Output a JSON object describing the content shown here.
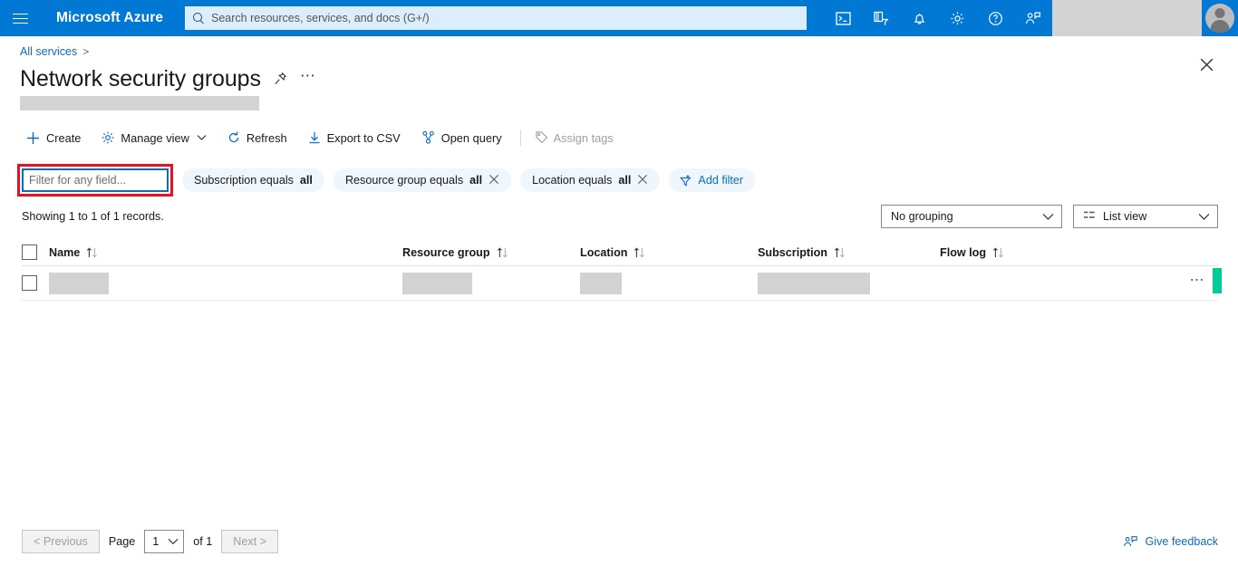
{
  "topbar": {
    "menu_icon": "hamburger-icon",
    "brand": "Microsoft Azure",
    "search": {
      "placeholder": "Search resources, services, and docs (G+/)",
      "icon": "search-icon"
    },
    "icons": [
      {
        "name": "cloud-shell-icon",
        "label": "Cloud Shell"
      },
      {
        "name": "directories-subscriptions-icon",
        "label": "Directories + subscriptions"
      },
      {
        "name": "notifications-bell-icon",
        "label": "Notifications"
      },
      {
        "name": "settings-gear-icon",
        "label": "Settings"
      },
      {
        "name": "help-question-icon",
        "label": "Help"
      },
      {
        "name": "feedback-person-icon",
        "label": "Feedback"
      }
    ],
    "account_redacted": true,
    "avatar": "user-avatar"
  },
  "breadcrumb": {
    "items": [
      "All services"
    ],
    "separator": ">"
  },
  "header": {
    "title": "Network security groups",
    "pin_icon": "pin-icon",
    "more_icon": "more-ellipsis-icon",
    "close_icon": "close-icon",
    "subtitle_redacted": true
  },
  "toolbar": {
    "items": [
      {
        "name": "create-button",
        "label": "Create",
        "icon": "plus-icon",
        "disabled": false,
        "chevron": false
      },
      {
        "name": "manage-view-button",
        "label": "Manage view",
        "icon": "gear-icon",
        "disabled": false,
        "chevron": true
      },
      {
        "name": "refresh-button",
        "label": "Refresh",
        "icon": "refresh-icon",
        "disabled": false,
        "chevron": false
      },
      {
        "name": "export-csv-button",
        "label": "Export to CSV",
        "icon": "download-icon",
        "disabled": false,
        "chevron": false
      },
      {
        "name": "open-query-button",
        "label": "Open query",
        "icon": "open-query-icon",
        "disabled": false,
        "chevron": false
      },
      {
        "name": "assign-tags-button",
        "label": "Assign tags",
        "icon": "tag-icon",
        "disabled": true,
        "chevron": false
      }
    ]
  },
  "filters": {
    "text_filter": {
      "placeholder": "Filter for any field...",
      "value": "",
      "focused": true,
      "highlight_color": "#e81123"
    },
    "pills": [
      {
        "name": "filter-pill-subscription",
        "prefix": "Subscription equals",
        "value": "all",
        "removable": false
      },
      {
        "name": "filter-pill-resource-group",
        "prefix": "Resource group equals",
        "value": "all",
        "removable": true
      },
      {
        "name": "filter-pill-location",
        "prefix": "Location equals",
        "value": "all",
        "removable": true
      }
    ],
    "add_filter": {
      "label": "Add filter",
      "icon": "add-filter-icon"
    }
  },
  "results": {
    "records_text": "Showing 1 to 1 of 1 records.",
    "grouping_select": {
      "value": "No grouping",
      "icon": "chevron-down-icon"
    },
    "view_select": {
      "value": "List view",
      "icon": "list-view-icon"
    }
  },
  "table": {
    "select_all_checkbox": false,
    "columns": [
      {
        "name": "column-name",
        "label": "Name",
        "sortable": true
      },
      {
        "name": "column-resource-group",
        "label": "Resource group",
        "sortable": true
      },
      {
        "name": "column-location",
        "label": "Location",
        "sortable": true
      },
      {
        "name": "column-subscription",
        "label": "Subscription",
        "sortable": true
      },
      {
        "name": "column-flow-log",
        "label": "Flow log",
        "sortable": true
      }
    ],
    "rows": [
      {
        "selected": false,
        "name": "",
        "resource_group": "",
        "location": "",
        "subscription": "",
        "flow_log": "",
        "redacted": true,
        "row_menu_icon": "more-ellipsis-icon"
      }
    ]
  },
  "footer": {
    "previous_label": "< Previous",
    "previous_disabled": true,
    "page_label": "Page",
    "page_value": "1",
    "of_label": "of 1",
    "next_label": "Next >",
    "next_disabled": true,
    "feedback_label": "Give feedback",
    "feedback_icon": "feedback-person-icon"
  },
  "colors": {
    "azure_blue": "#0078d4",
    "link_blue": "#0f6cbd",
    "pill_bg": "#eff6fc",
    "annotation_red": "#e81123",
    "cursor_green": "#00cc99",
    "redaction_gray": "#d2d2d2"
  }
}
